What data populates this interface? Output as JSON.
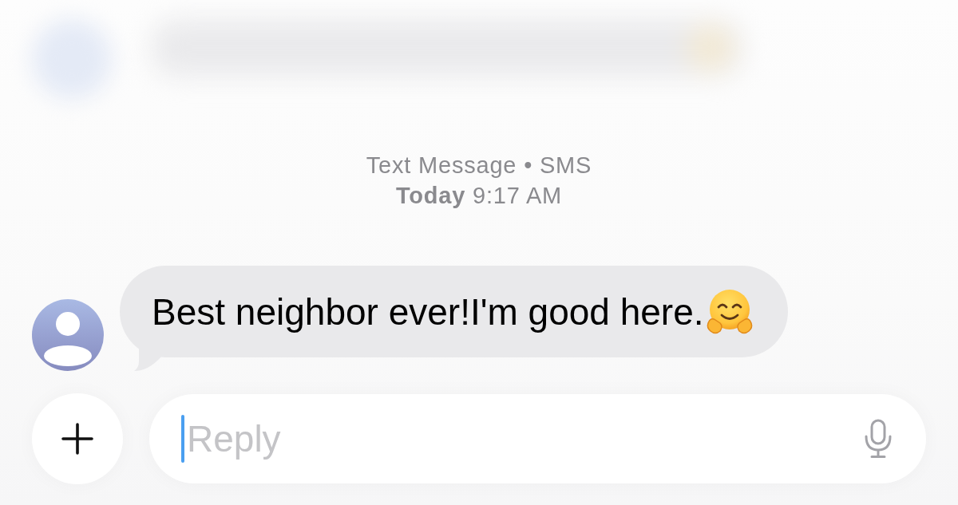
{
  "thread_info": {
    "service": "Text Message • SMS",
    "timestamp": "**Today** 9:17 AM"
  },
  "messages": [
    {
      "text": "Best neighbor ever!I'm good here."
    }
  ],
  "composer": {
    "placeholder": "Reply",
    "focused": true
  }
}
